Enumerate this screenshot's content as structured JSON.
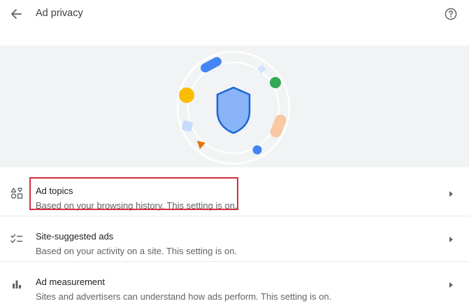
{
  "header": {
    "title": "Ad privacy",
    "back_icon": "arrow-back-icon",
    "help_icon": "help-circle-icon"
  },
  "hero": {
    "illustration": "shield-privacy-illustration"
  },
  "rows": [
    {
      "title": "Ad topics",
      "description": "Based on your browsing history. This setting is on.",
      "icon": "shapes-icon",
      "highlighted": true
    },
    {
      "title": "Site-suggested ads",
      "description": "Based on your activity on a site. This setting is on.",
      "icon": "checklist-icon",
      "highlighted": false
    },
    {
      "title": "Ad measurement",
      "description": "Sites and advertisers can understand how ads perform. This setting is on.",
      "icon": "bar-chart-icon",
      "highlighted": false
    }
  ],
  "colors": {
    "accent_blue": "#4285f4",
    "highlight_red": "#d32f3f",
    "hero_background": "#f1f3f4"
  }
}
